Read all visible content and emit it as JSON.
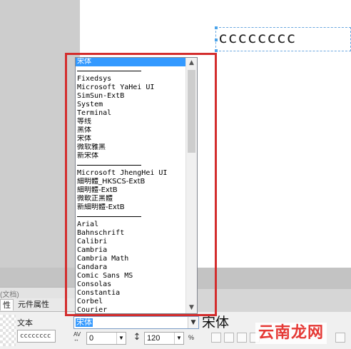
{
  "canvas": {
    "text": "cccccccc"
  },
  "docbar": {
    "label": "(文档)"
  },
  "tabs": [
    {
      "label": "性"
    },
    {
      "label": "元件属性"
    }
  ],
  "text_prop": {
    "label": "文本",
    "value": "cccccccc",
    "font_value": "宋体",
    "preview": "宋体",
    "letter_spacing": "0",
    "line_height": "120",
    "av_label": "AV",
    "pct_label": "%"
  },
  "font_list": {
    "items": [
      {
        "label": "宋体",
        "selected": true,
        "kind": "cjk"
      },
      {
        "label": "",
        "kind": "sep"
      },
      {
        "label": "Fixedsys"
      },
      {
        "label": "Microsoft YaHei UI"
      },
      {
        "label": "SimSun-ExtB"
      },
      {
        "label": "System"
      },
      {
        "label": "Terminal"
      },
      {
        "label": "等线",
        "kind": "cjk"
      },
      {
        "label": "黑体",
        "kind": "cjk"
      },
      {
        "label": "宋体",
        "kind": "cjk"
      },
      {
        "label": "微软雅黑",
        "kind": "cjk"
      },
      {
        "label": "新宋体",
        "kind": "cjk"
      },
      {
        "label": "",
        "kind": "sep"
      },
      {
        "label": "Microsoft JhengHei UI"
      },
      {
        "label": "細明體_HKSCS-ExtB",
        "kind": "cjk"
      },
      {
        "label": "細明體-ExtB",
        "kind": "cjk"
      },
      {
        "label": "微軟正黑體",
        "kind": "cjk"
      },
      {
        "label": "新細明體-ExtB",
        "kind": "cjk"
      },
      {
        "label": "",
        "kind": "sep"
      },
      {
        "label": "Arial"
      },
      {
        "label": "Bahnschrift"
      },
      {
        "label": "Calibri"
      },
      {
        "label": "Cambria"
      },
      {
        "label": "Cambria Math"
      },
      {
        "label": "Candara"
      },
      {
        "label": "Comic Sans MS"
      },
      {
        "label": "Consolas"
      },
      {
        "label": "Constantia"
      },
      {
        "label": "Corbel"
      },
      {
        "label": "Courier"
      }
    ]
  },
  "watermark": {
    "text": "云南龙网"
  },
  "colors": {
    "highlight": "#3399ff",
    "annotation": "#d32d2d",
    "watermark": "#e53935"
  },
  "icons": [
    "chevron-up-icon",
    "chevron-down-icon",
    "line-height-icon",
    "letter-spacing-icon"
  ]
}
